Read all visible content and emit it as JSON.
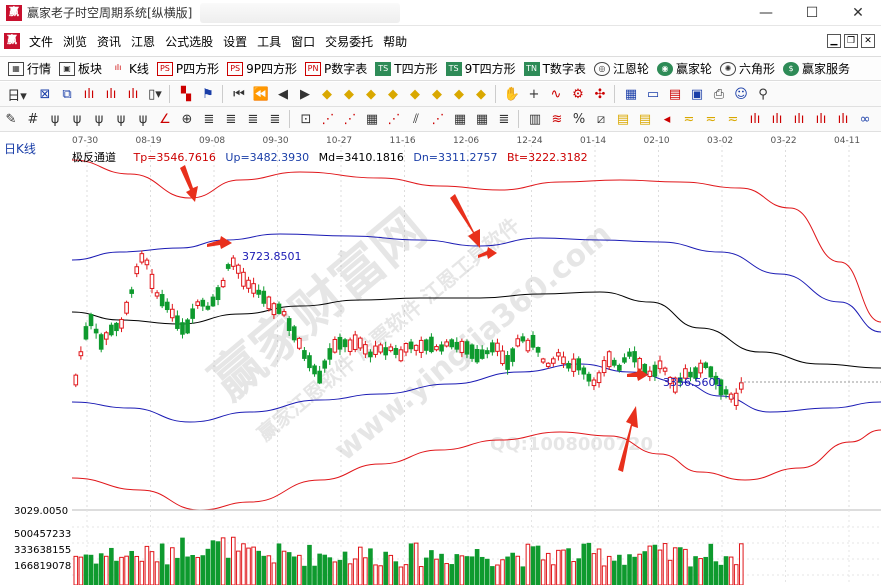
{
  "window": {
    "title": "赢家老子时空周期系统[纵横版]",
    "controls": [
      "—",
      "☐",
      "✕"
    ]
  },
  "app_icon_text": "赢",
  "menu": {
    "items": [
      "文件",
      "浏览",
      "资讯",
      "江恩",
      "公式选股",
      "设置",
      "工具",
      "窗口",
      "交易委托",
      "帮助"
    ]
  },
  "funcbar": {
    "buttons": [
      {
        "label": "行情",
        "icon": "grid-icon"
      },
      {
        "label": "板块",
        "icon": "blocks-icon"
      },
      {
        "label": "K线",
        "icon": "candles-icon"
      },
      {
        "label": "P四方形",
        "icon": "ps-icon"
      },
      {
        "label": "9P四方形",
        "icon": "ps-icon"
      },
      {
        "label": "P数字表",
        "icon": "pn-icon"
      },
      {
        "label": "T四方形",
        "icon": "ts-icon"
      },
      {
        "label": "9T四方形",
        "icon": "ts-icon"
      },
      {
        "label": "T数字表",
        "icon": "tn-icon"
      },
      {
        "label": "江恩轮",
        "icon": "wheel-icon"
      },
      {
        "label": "赢家轮",
        "icon": "wheel-icon"
      },
      {
        "label": "六角形",
        "icon": "hex-icon"
      },
      {
        "label": "赢家服务",
        "icon": "dollar-icon"
      }
    ]
  },
  "chart": {
    "period_label": "日K线",
    "indicator": {
      "name": "极反通道",
      "tp": "Tp=3546.7616",
      "up": "Up=3482.3930",
      "md": "Md=3410.1816",
      "dn": "Dn=3311.2757",
      "bt": "Bt=3222.3182"
    },
    "date_labels": [
      "07-30",
      "08-19",
      "09-08",
      "09-30",
      "10-27",
      "11-16",
      "12-06",
      "12-24",
      "01-14",
      "02-10",
      "03-02",
      "03-22",
      "04-11"
    ],
    "annotation_high": "3723.8501",
    "annotation_low": "3356.5601",
    "volume_axis": [
      "3029.0050",
      "500457233",
      "333638155",
      "166819078"
    ],
    "watermarks": [
      "赢家财富网",
      "赢家江恩软件 股票软件 江恩工具软件",
      "www.yingjia360.com",
      "QQ:1008000720"
    ],
    "colors": {
      "up": "#e0161a",
      "down": "#0e9a2e",
      "tp_bt": "#e0161a",
      "up_dn": "#1a1ab4",
      "md": "#000000"
    }
  }
}
